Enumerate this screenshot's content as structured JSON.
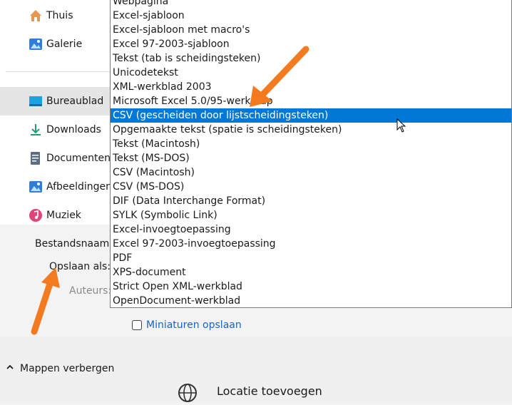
{
  "nav": {
    "items": [
      {
        "label": "Thuis",
        "icon": "home-icon"
      },
      {
        "label": "Galerie",
        "icon": "gallery-icon"
      },
      {
        "label": "Bureaublad",
        "icon": "desktop-icon",
        "selected": true
      },
      {
        "label": "Downloads",
        "icon": "download-icon"
      },
      {
        "label": "Documenten",
        "icon": "document-icon"
      },
      {
        "label": "Afbeeldingen",
        "icon": "pictures-icon"
      },
      {
        "label": "Muziek",
        "icon": "music-icon"
      }
    ]
  },
  "form": {
    "filename_label": "Bestandsnaam:",
    "savetype_label": "Opslaan als:",
    "authors_label": "Auteurs:"
  },
  "dropdown": {
    "options": [
      "Webpagina",
      "Excel-sjabloon",
      "Excel-sjabloon met macro's",
      "Excel 97-2003-sjabloon",
      "Tekst (tab is scheidingsteken)",
      "Unicodetekst",
      "XML-werkblad 2003",
      "Microsoft Excel 5.0/95-werkmap",
      "CSV (gescheiden door lijstscheidingsteken)",
      "Opgemaakte tekst (spatie is scheidingsteken)",
      "Tekst (Macintosh)",
      "Tekst (MS-DOS)",
      "CSV (Macintosh)",
      "CSV (MS-DOS)",
      "DIF (Data Interchange Format)",
      "SYLK (Symbolic Link)",
      "Excel-invoegtoepassing",
      "Excel 97-2003-invoegtoepassing",
      "PDF",
      "XPS-document",
      "Strict Open XML-werkblad",
      "OpenDocument-werkblad"
    ],
    "selected_index": 8
  },
  "thumbnails": {
    "label": "Miniaturen opslaan",
    "checked": false
  },
  "footer": {
    "hide_folders_label": "Mappen verbergen",
    "add_location_label": "Locatie toevoegen"
  },
  "colors": {
    "selection": "#0078d7",
    "arrow": "#f47a1f",
    "link": "#1565c0"
  }
}
